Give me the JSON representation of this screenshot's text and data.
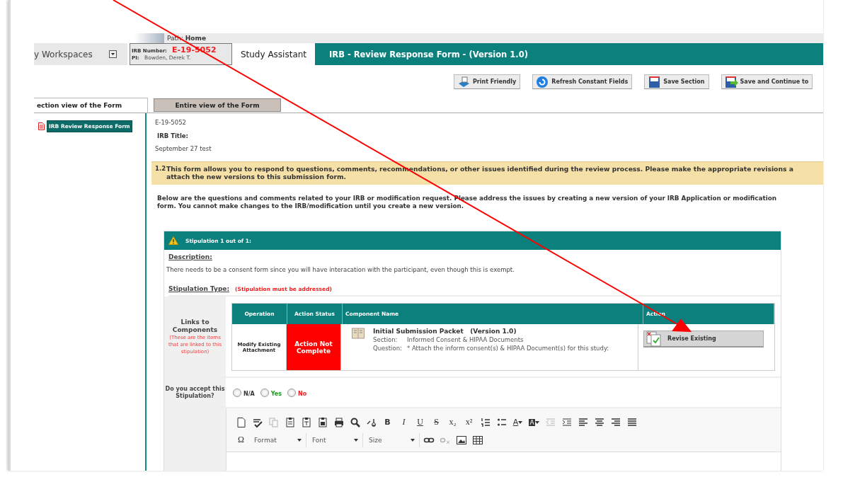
{
  "path_bar": {
    "label": "Path:",
    "value": "Home"
  },
  "header": {
    "workspaces": "y Workspaces",
    "irb_number_label": "IRB Number:",
    "irb_number": "E-19-5052",
    "pi_label": "PI:",
    "pi": "Bowden, Derek T.",
    "study_assistant": "Study Assistant",
    "form_title": "IRB - Review Response Form - (Version 1.0)"
  },
  "toolbar": [
    {
      "kind": "print",
      "label": "Print Friendly"
    },
    {
      "kind": "refresh",
      "label": "Refresh Constant Fields"
    },
    {
      "kind": "save",
      "label": "Save Section"
    },
    {
      "kind": "save-continue",
      "label": "Save and Continue to"
    }
  ],
  "tabs": [
    {
      "label": "ection view of the Form",
      "selected": true
    },
    {
      "label": "Entire view of the Form",
      "selected": false
    }
  ],
  "sidebar": {
    "items": [
      {
        "label": "IRB Review Response Form",
        "selected": true
      }
    ]
  },
  "info": {
    "number": "E-19-5052",
    "title_label": "IRB Title:",
    "title": "September 27 test"
  },
  "notice": {
    "number": "1.2",
    "lines": [
      "This form allows you to respond to questions, comments, recommendations, or other issues identified during the review process. Please make the appropriate revisions a",
      "attach the new versions to this submission form."
    ]
  },
  "intro": "Below are the questions and comments related to your IRB or modification request. Please address the issues by creating a new version of your IRB Application or modification form. You cannot make changes to the IRB/modification until you create a new version.",
  "stipulation": {
    "heading": "Stipulation 1 out of 1:",
    "description_label": "Description:",
    "description": "There needs to be a consent form since you will have interacation with the participant, even though this is exempt.",
    "type_label": "Stipulation Type:",
    "type": "(Stipulation must be addressed)",
    "links_label": "Links to Components",
    "links_note": "(These are the items that are linked to this stipulation)",
    "table": {
      "columns": [
        "Operation",
        "Action Status",
        "Component Name",
        "Action"
      ],
      "rows": [
        {
          "operation": "Modify Existing Attachment",
          "status": "Action Not Complete",
          "complete": false,
          "component": "Initial Submission Packet   (Version 1.0)",
          "section_label": "Section:",
          "section": "Informed Consent & HIPAA Documents",
          "question_label": "Question:",
          "question": "* Attach the inform consent(s) & HIPAA Document(s) for this study:",
          "action": "Revise Existing"
        }
      ]
    },
    "accept_label": "Do you accept this Stipulation?",
    "options": [
      {
        "label": "N/A",
        "kind": "neutral",
        "selected": false
      },
      {
        "label": "Yes",
        "kind": "yes",
        "selected": false
      },
      {
        "label": "No",
        "kind": "no",
        "selected": false
      }
    ]
  },
  "editor": {
    "rows": [
      [
        {
          "kind": "new",
          "disabled": false
        },
        {
          "kind": "spell",
          "disabled": false
        },
        {
          "kind": "copy",
          "disabled": true
        },
        {
          "kind": "paste",
          "disabled": false
        },
        {
          "kind": "paste-text",
          "disabled": false
        },
        {
          "kind": "paste-word",
          "disabled": false
        },
        {
          "kind": "print",
          "disabled": false
        },
        {
          "kind": "find",
          "disabled": false
        },
        {
          "kind": "replace",
          "disabled": false
        },
        {
          "kind": "bold",
          "label": "B",
          "disabled": false
        },
        {
          "kind": "italic",
          "label": "I",
          "disabled": false
        },
        {
          "kind": "underline",
          "label": "U",
          "disabled": false
        },
        {
          "kind": "strike",
          "label": "S",
          "disabled": false
        },
        {
          "kind": "subscript",
          "label": "x₂",
          "disabled": false
        },
        {
          "kind": "superscript",
          "label": "x²",
          "disabled": false
        },
        {
          "kind": "numbered-list",
          "disabled": false
        },
        {
          "kind": "bullet-list",
          "disabled": false
        },
        {
          "kind": "text-color",
          "label": "A",
          "disabled": false
        },
        {
          "kind": "bg-color",
          "label": "A",
          "disabled": false
        },
        {
          "kind": "outdent",
          "disabled": true
        },
        {
          "kind": "indent",
          "disabled": false
        },
        {
          "kind": "align-left",
          "disabled": false
        },
        {
          "kind": "align-center",
          "disabled": false
        },
        {
          "kind": "align-right",
          "disabled": false
        },
        {
          "kind": "justify",
          "disabled": false
        }
      ],
      [
        {
          "kind": "symbol",
          "label": "Ω",
          "disabled": false
        },
        {
          "kind": "combo",
          "label": "Format",
          "disabled": false
        },
        {
          "kind": "combo",
          "label": "Font",
          "disabled": false
        },
        {
          "kind": "combo",
          "label": "Size",
          "disabled": false
        },
        {
          "kind": "link",
          "disabled": false
        },
        {
          "kind": "unlink",
          "disabled": true
        },
        {
          "kind": "image",
          "disabled": false
        },
        {
          "kind": "table",
          "disabled": false
        }
      ]
    ]
  }
}
